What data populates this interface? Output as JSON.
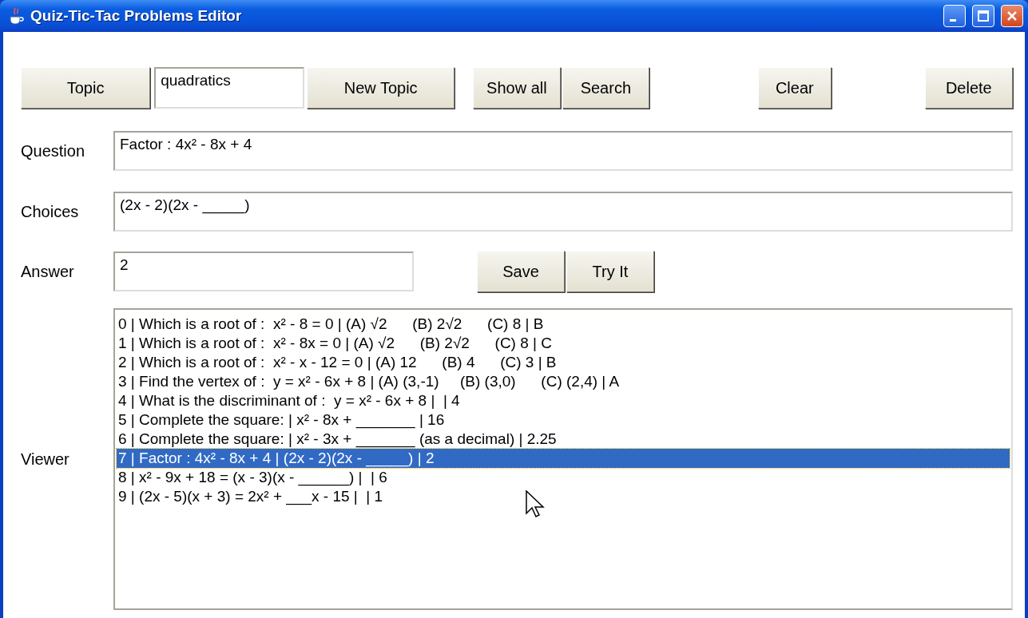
{
  "window": {
    "title": "Quiz-Tic-Tac Problems Editor"
  },
  "toolbar": {
    "topic_button": "Topic",
    "topic_field": "quadratics",
    "buttons": [
      "New Topic",
      "Show all",
      "Search",
      "Clear",
      "Delete"
    ]
  },
  "question": {
    "label": "Question",
    "value": "Factor : 4x² - 8x + 4"
  },
  "choices": {
    "label": "Choices",
    "value": "(2x - 2)(2x - _____)"
  },
  "answer": {
    "label": "Answer",
    "value": "2",
    "buttons": [
      "Save",
      "Try It"
    ]
  },
  "viewer": {
    "label": "Viewer",
    "rows": [
      {
        "text": "0 | Which is a root of :  x² - 8 = 0 | (A) √2      (B) 2√2      (C) 8 | B",
        "selected": false
      },
      {
        "text": "1 | Which is a root of :  x² - 8x = 0 | (A) √2      (B) 2√2      (C) 8 | C",
        "selected": false
      },
      {
        "text": "2 | Which is a root of :  x² - x - 12 = 0 | (A) 12      (B) 4      (C) 3 | B",
        "selected": false
      },
      {
        "text": "3 | Find the vertex of :  y = x² - 6x + 8 | (A) (3,-1)     (B) (3,0)      (C) (2,4) | A",
        "selected": false
      },
      {
        "text": "4 | What is the discriminant of :  y = x² - 6x + 8 |  | 4",
        "selected": false
      },
      {
        "text": "5 | Complete the square: | x² - 8x + _______ | 16",
        "selected": false
      },
      {
        "text": "6 | Complete the square: | x² - 3x + _______ (as a decimal) | 2.25",
        "selected": false
      },
      {
        "text": "7 | Factor : 4x² - 8x + 4 | (2x - 2)(2x - _____) | 2",
        "selected": true
      },
      {
        "text": "8 | x² - 9x + 18 = (x - 3)(x - ______) |  | 6",
        "selected": false
      },
      {
        "text": "9 | (2x - 5)(x + 3) = 2x² + ___x - 15 |  | 1",
        "selected": false
      }
    ]
  }
}
